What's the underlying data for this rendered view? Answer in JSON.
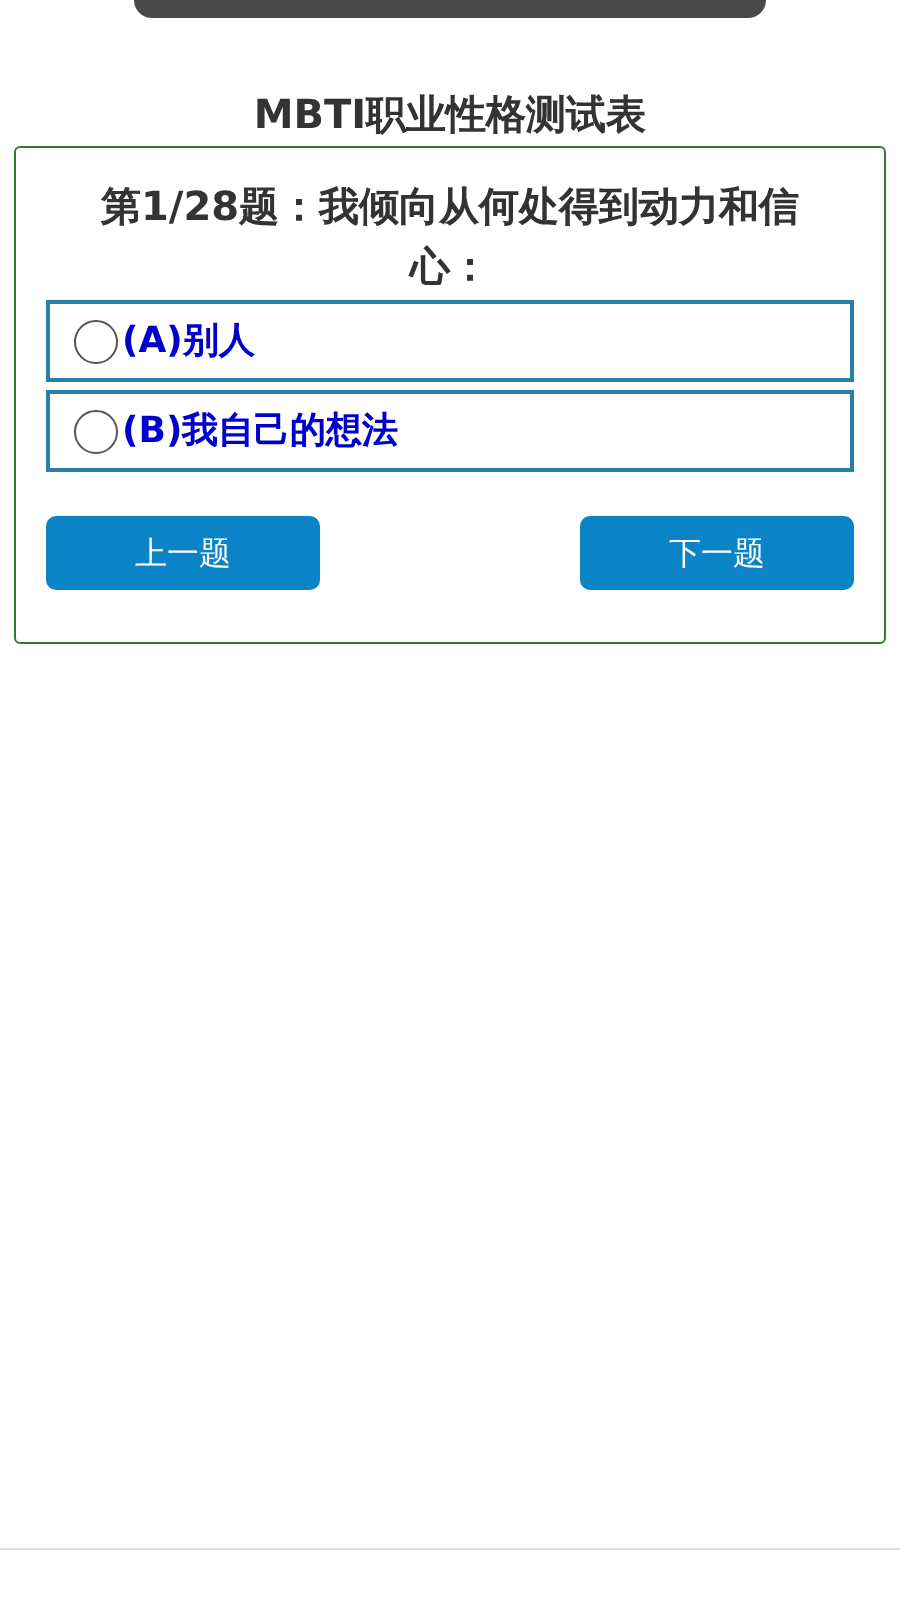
{
  "title": "MBTI职业性格测试表",
  "question": "第1/28题：我倾向从何处得到动力和信心：",
  "options": [
    {
      "label": "(A)别人",
      "selected": false
    },
    {
      "label": "(B)我自己的想法",
      "selected": false
    }
  ],
  "buttons": [
    "上一题",
    "下一题"
  ]
}
